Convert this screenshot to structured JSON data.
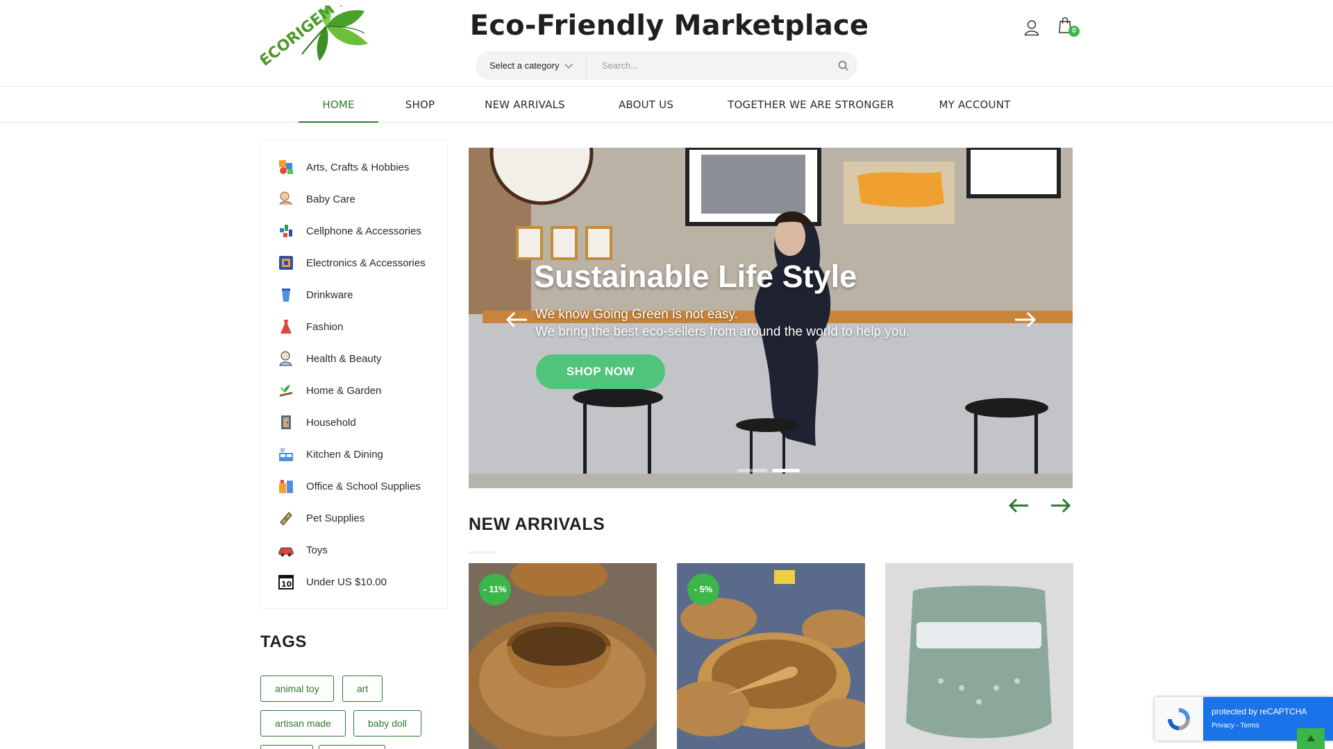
{
  "header": {
    "site_title": "Eco-Friendly Marketplace",
    "logo_alt": "ECORIGEM .COM",
    "cart_count": "0"
  },
  "search": {
    "category_label": "Select a category",
    "placeholder": "Search..."
  },
  "nav": {
    "items": [
      "HOME",
      "SHOP",
      "NEW ARRIVALS",
      "ABOUT US",
      "TOGETHER WE ARE STRONGER",
      "MY ACCOUNT"
    ],
    "active": "HOME"
  },
  "categories": [
    {
      "label": "Arts, Crafts & Hobbies",
      "icon": "arts-crafts-icon"
    },
    {
      "label": "Baby Care",
      "icon": "baby-care-icon"
    },
    {
      "label": "Cellphone & Accessories",
      "icon": "cellphone-icon"
    },
    {
      "label": "Electronics & Accessories",
      "icon": "electronics-icon"
    },
    {
      "label": "Drinkware",
      "icon": "drinkware-icon"
    },
    {
      "label": "Fashion",
      "icon": "fashion-icon"
    },
    {
      "label": "Health & Beauty",
      "icon": "health-beauty-icon"
    },
    {
      "label": "Home & Garden",
      "icon": "home-garden-icon"
    },
    {
      "label": "Household",
      "icon": "household-icon"
    },
    {
      "label": "Kitchen & Dining",
      "icon": "kitchen-dining-icon"
    },
    {
      "label": "Office & School Supplies",
      "icon": "office-supplies-icon"
    },
    {
      "label": "Pet Supplies",
      "icon": "pet-supplies-icon"
    },
    {
      "label": "Toys",
      "icon": "toys-icon"
    },
    {
      "label": "Under US $10.00",
      "icon": "under-ten-icon"
    }
  ],
  "tags": {
    "title": "TAGS",
    "items": [
      "animal toy",
      "art",
      "artisan made",
      "baby doll"
    ]
  },
  "hero": {
    "title": "Sustainable Life Style",
    "line1": "We know Going Green is not easy.",
    "line2": "We bring the best eco-sellers from around the world to help you.",
    "button": "SHOP NOW",
    "slide_count": 2,
    "active_slide": 2
  },
  "new_arrivals": {
    "title": "NEW ARRIVALS",
    "products": [
      {
        "badge": "- 11%",
        "image": "wooden-cup-and-plate"
      },
      {
        "badge": "- 5%",
        "image": "wooden-bowls-and-spoon"
      },
      {
        "badge": "",
        "image": "green-cloth-diaper"
      }
    ]
  },
  "recaptcha": {
    "text": "protected by reCAPTCHA",
    "links": "Privacy - Terms"
  },
  "colors": {
    "brand_green": "#2c7a2e",
    "accent_green": "#3cb54a",
    "button_green": "#4fc47a",
    "recaptcha_blue": "#1a73e8"
  }
}
